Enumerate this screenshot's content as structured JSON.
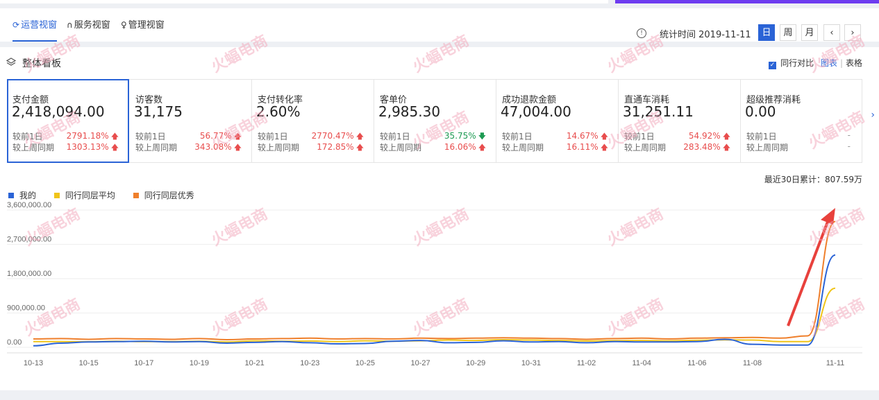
{
  "tabs": [
    {
      "label": "运营视窗",
      "icon": "refresh-icon"
    },
    {
      "label": "服务视窗",
      "icon": "headset-icon"
    },
    {
      "label": "管理视窗",
      "icon": "person-icon"
    }
  ],
  "header": {
    "stat_time_label": "统计时间 2019-11-11",
    "info_icon": "!",
    "periods": [
      "日",
      "周",
      "月"
    ],
    "prev": "‹",
    "next": "›"
  },
  "panel": {
    "title": "整体看板",
    "compare_label": "同行对比",
    "view_chart": "图表",
    "view_table": "表格",
    "total_label": "最近30日累计：807.59万"
  },
  "metrics": [
    {
      "label": "支付金额",
      "value": "2,418,094.00",
      "row1_label": "较前1日",
      "row1_value": "2791.18%",
      "row1_dir": "up",
      "row2_label": "较上周同期",
      "row2_value": "1303.13%",
      "row2_dir": "up"
    },
    {
      "label": "访客数",
      "value": "31,175",
      "row1_label": "较前1日",
      "row1_value": "56.77%",
      "row1_dir": "up",
      "row2_label": "较上周同期",
      "row2_value": "343.08%",
      "row2_dir": "up"
    },
    {
      "label": "支付转化率",
      "value": "2.60%",
      "row1_label": "较前1日",
      "row1_value": "2770.47%",
      "row1_dir": "up",
      "row2_label": "较上周同期",
      "row2_value": "172.85%",
      "row2_dir": "up"
    },
    {
      "label": "客单价",
      "value": "2,985.30",
      "row1_label": "较前1日",
      "row1_value": "35.75%",
      "row1_dir": "down",
      "row2_label": "较上周同期",
      "row2_value": "16.06%",
      "row2_dir": "up"
    },
    {
      "label": "成功退款金额",
      "value": "47,004.00",
      "row1_label": "较前1日",
      "row1_value": "14.67%",
      "row1_dir": "up",
      "row2_label": "较上周同期",
      "row2_value": "16.11%",
      "row2_dir": "up"
    },
    {
      "label": "直通车消耗",
      "value": "31,251.11",
      "row1_label": "较前1日",
      "row1_value": "54.92%",
      "row1_dir": "up",
      "row2_label": "较上周同期",
      "row2_value": "283.48%",
      "row2_dir": "up"
    },
    {
      "label": "超级推荐消耗",
      "value": "0.00",
      "row1_label": "较前1日",
      "row1_value": "-",
      "row1_dir": "none",
      "row2_label": "较上周同期",
      "row2_value": "-",
      "row2_dir": "none"
    }
  ],
  "watermark": {
    "text": "火蝠电商"
  },
  "colors": {
    "accent": "#2a63d6",
    "up": "#e84d4d",
    "down": "#1d9a52",
    "mine": "#2a63d6",
    "avg": "#f0c419",
    "excellent": "#ef7f2b",
    "arrow": "#e8413c"
  },
  "chart_data": {
    "type": "line",
    "x": [
      "10-13",
      "10-14",
      "10-15",
      "10-16",
      "10-17",
      "10-18",
      "10-19",
      "10-20",
      "10-21",
      "10-22",
      "10-23",
      "10-24",
      "10-25",
      "10-26",
      "10-27",
      "10-28",
      "10-29",
      "10-30",
      "10-31",
      "11-01",
      "11-02",
      "11-03",
      "11-04",
      "11-05",
      "11-06",
      "11-07",
      "11-08",
      "11-09",
      "11-10",
      "11-11"
    ],
    "tick_labels": [
      "10-13",
      "10-15",
      "10-17",
      "10-19",
      "10-21",
      "10-23",
      "10-25",
      "10-27",
      "10-29",
      "10-31",
      "11-02",
      "11-04",
      "11-06",
      "11-08",
      "11-11"
    ],
    "yticks": [
      "0.00",
      "900,000.00",
      "1,800,000.00",
      "2,700,000.00",
      "3,600,000.00"
    ],
    "ylim": [
      0,
      3600000
    ],
    "series": [
      {
        "name": "我的",
        "values": [
          40000,
          110000,
          140000,
          150000,
          160000,
          140000,
          150000,
          110000,
          130000,
          150000,
          120000,
          90000,
          100000,
          160000,
          180000,
          120000,
          130000,
          170000,
          140000,
          150000,
          120000,
          150000,
          140000,
          140000,
          150000,
          210000,
          80000,
          60000,
          60000,
          2420000
        ]
      },
      {
        "name": "同行同层平均",
        "values": [
          150000,
          150000,
          145000,
          160000,
          150000,
          150000,
          160000,
          140000,
          170000,
          160000,
          165000,
          150000,
          170000,
          160000,
          170000,
          190000,
          180000,
          200000,
          190000,
          180000,
          165000,
          175000,
          180000,
          170000,
          185000,
          195000,
          190000,
          150000,
          150000,
          1550000
        ]
      },
      {
        "name": "同行同层优秀",
        "values": [
          220000,
          230000,
          210000,
          230000,
          220000,
          210000,
          230000,
          200000,
          220000,
          230000,
          240000,
          220000,
          230000,
          220000,
          240000,
          230000,
          240000,
          250000,
          240000,
          230000,
          210000,
          230000,
          240000,
          220000,
          240000,
          250000,
          260000,
          240000,
          300000,
          3300000
        ]
      }
    ],
    "grid": true,
    "legend": "top-left"
  }
}
